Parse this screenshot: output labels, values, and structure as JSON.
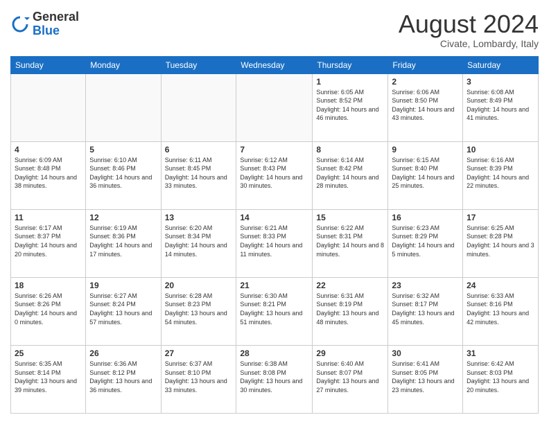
{
  "header": {
    "logo": {
      "general": "General",
      "blue": "Blue"
    },
    "title": "August 2024",
    "location": "Civate, Lombardy, Italy"
  },
  "days_of_week": [
    "Sunday",
    "Monday",
    "Tuesday",
    "Wednesday",
    "Thursday",
    "Friday",
    "Saturday"
  ],
  "weeks": [
    [
      {
        "day": "",
        "info": ""
      },
      {
        "day": "",
        "info": ""
      },
      {
        "day": "",
        "info": ""
      },
      {
        "day": "",
        "info": ""
      },
      {
        "day": "1",
        "info": "Sunrise: 6:05 AM\nSunset: 8:52 PM\nDaylight: 14 hours and 46 minutes."
      },
      {
        "day": "2",
        "info": "Sunrise: 6:06 AM\nSunset: 8:50 PM\nDaylight: 14 hours and 43 minutes."
      },
      {
        "day": "3",
        "info": "Sunrise: 6:08 AM\nSunset: 8:49 PM\nDaylight: 14 hours and 41 minutes."
      }
    ],
    [
      {
        "day": "4",
        "info": "Sunrise: 6:09 AM\nSunset: 8:48 PM\nDaylight: 14 hours and 38 minutes."
      },
      {
        "day": "5",
        "info": "Sunrise: 6:10 AM\nSunset: 8:46 PM\nDaylight: 14 hours and 36 minutes."
      },
      {
        "day": "6",
        "info": "Sunrise: 6:11 AM\nSunset: 8:45 PM\nDaylight: 14 hours and 33 minutes."
      },
      {
        "day": "7",
        "info": "Sunrise: 6:12 AM\nSunset: 8:43 PM\nDaylight: 14 hours and 30 minutes."
      },
      {
        "day": "8",
        "info": "Sunrise: 6:14 AM\nSunset: 8:42 PM\nDaylight: 14 hours and 28 minutes."
      },
      {
        "day": "9",
        "info": "Sunrise: 6:15 AM\nSunset: 8:40 PM\nDaylight: 14 hours and 25 minutes."
      },
      {
        "day": "10",
        "info": "Sunrise: 6:16 AM\nSunset: 8:39 PM\nDaylight: 14 hours and 22 minutes."
      }
    ],
    [
      {
        "day": "11",
        "info": "Sunrise: 6:17 AM\nSunset: 8:37 PM\nDaylight: 14 hours and 20 minutes."
      },
      {
        "day": "12",
        "info": "Sunrise: 6:19 AM\nSunset: 8:36 PM\nDaylight: 14 hours and 17 minutes."
      },
      {
        "day": "13",
        "info": "Sunrise: 6:20 AM\nSunset: 8:34 PM\nDaylight: 14 hours and 14 minutes."
      },
      {
        "day": "14",
        "info": "Sunrise: 6:21 AM\nSunset: 8:33 PM\nDaylight: 14 hours and 11 minutes."
      },
      {
        "day": "15",
        "info": "Sunrise: 6:22 AM\nSunset: 8:31 PM\nDaylight: 14 hours and 8 minutes."
      },
      {
        "day": "16",
        "info": "Sunrise: 6:23 AM\nSunset: 8:29 PM\nDaylight: 14 hours and 5 minutes."
      },
      {
        "day": "17",
        "info": "Sunrise: 6:25 AM\nSunset: 8:28 PM\nDaylight: 14 hours and 3 minutes."
      }
    ],
    [
      {
        "day": "18",
        "info": "Sunrise: 6:26 AM\nSunset: 8:26 PM\nDaylight: 14 hours and 0 minutes."
      },
      {
        "day": "19",
        "info": "Sunrise: 6:27 AM\nSunset: 8:24 PM\nDaylight: 13 hours and 57 minutes."
      },
      {
        "day": "20",
        "info": "Sunrise: 6:28 AM\nSunset: 8:23 PM\nDaylight: 13 hours and 54 minutes."
      },
      {
        "day": "21",
        "info": "Sunrise: 6:30 AM\nSunset: 8:21 PM\nDaylight: 13 hours and 51 minutes."
      },
      {
        "day": "22",
        "info": "Sunrise: 6:31 AM\nSunset: 8:19 PM\nDaylight: 13 hours and 48 minutes."
      },
      {
        "day": "23",
        "info": "Sunrise: 6:32 AM\nSunset: 8:17 PM\nDaylight: 13 hours and 45 minutes."
      },
      {
        "day": "24",
        "info": "Sunrise: 6:33 AM\nSunset: 8:16 PM\nDaylight: 13 hours and 42 minutes."
      }
    ],
    [
      {
        "day": "25",
        "info": "Sunrise: 6:35 AM\nSunset: 8:14 PM\nDaylight: 13 hours and 39 minutes."
      },
      {
        "day": "26",
        "info": "Sunrise: 6:36 AM\nSunset: 8:12 PM\nDaylight: 13 hours and 36 minutes."
      },
      {
        "day": "27",
        "info": "Sunrise: 6:37 AM\nSunset: 8:10 PM\nDaylight: 13 hours and 33 minutes."
      },
      {
        "day": "28",
        "info": "Sunrise: 6:38 AM\nSunset: 8:08 PM\nDaylight: 13 hours and 30 minutes."
      },
      {
        "day": "29",
        "info": "Sunrise: 6:40 AM\nSunset: 8:07 PM\nDaylight: 13 hours and 27 minutes."
      },
      {
        "day": "30",
        "info": "Sunrise: 6:41 AM\nSunset: 8:05 PM\nDaylight: 13 hours and 23 minutes."
      },
      {
        "day": "31",
        "info": "Sunrise: 6:42 AM\nSunset: 8:03 PM\nDaylight: 13 hours and 20 minutes."
      }
    ]
  ]
}
